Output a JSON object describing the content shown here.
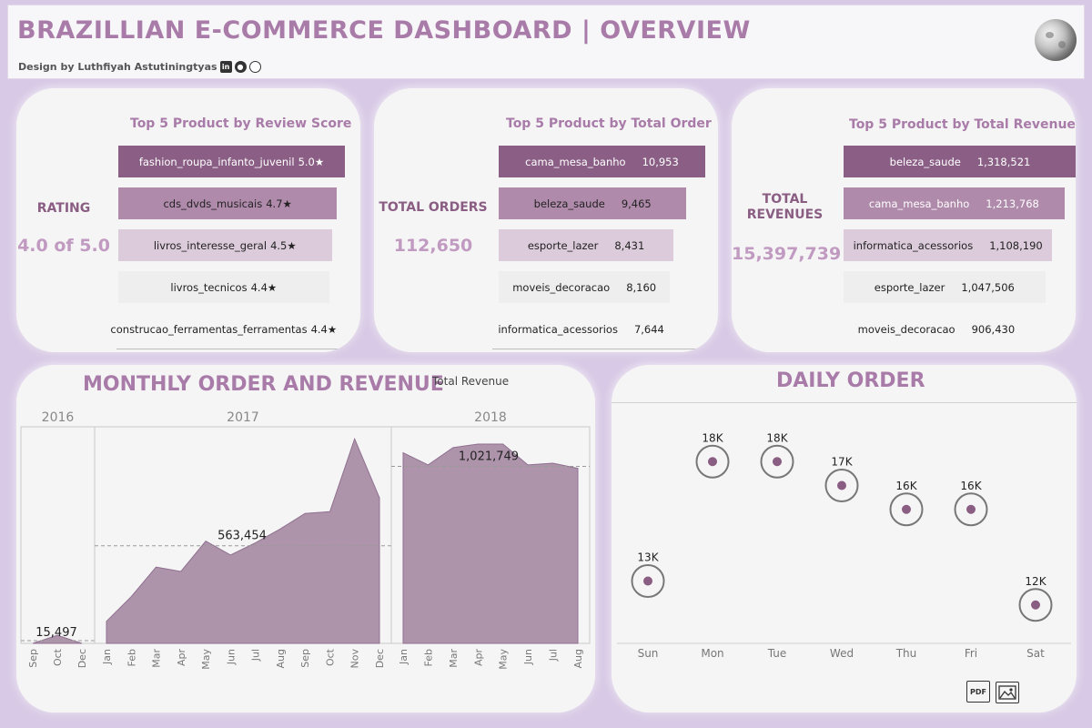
{
  "header": {
    "title": "BRAZILLIAN E-COMMERCE DASHBOARD | OVERVIEW",
    "byline": "Design by Luthfiyah Astutiningtyas"
  },
  "kpi_review": {
    "title": "Top 5 Product by Review Score",
    "label": "RATING",
    "value": "4.0 of 5.0",
    "bars": [
      {
        "name": "fashion_roupa_infanto_juvenil",
        "value": "5.0★",
        "score": 5.0
      },
      {
        "name": "cds_dvds_musicais",
        "value": "4.7★",
        "score": 4.7
      },
      {
        "name": "livros_interesse_geral",
        "value": "4.5★",
        "score": 4.5
      },
      {
        "name": "livros_tecnicos",
        "value": "4.4★",
        "score": 4.4
      },
      {
        "name": "construcao_ferramentas_ferramentas",
        "value": "4.4★",
        "score": 4.4
      }
    ]
  },
  "kpi_orders": {
    "title": "Top 5 Product by Total Order",
    "label": "TOTAL ORDERS",
    "value": "112,650",
    "bars": [
      {
        "name": "cama_mesa_banho",
        "value": "10,953",
        "amount": 10953
      },
      {
        "name": "beleza_saude",
        "value": "9,465",
        "amount": 9465
      },
      {
        "name": "esporte_lazer",
        "value": "8,431",
        "amount": 8431
      },
      {
        "name": "moveis_decoracao",
        "value": "8,160",
        "amount": 8160
      },
      {
        "name": "informatica_acessorios",
        "value": "7,644",
        "amount": 7644
      }
    ]
  },
  "kpi_revenue": {
    "title": "Top 5 Product by Total Revenue",
    "label_line1": "TOTAL",
    "label_line2": "REVENUES",
    "value": "15,397,739",
    "bars": [
      {
        "name": "beleza_saude",
        "value": "1,318,521",
        "amount": 1318521
      },
      {
        "name": "cama_mesa_banho",
        "value": "1,213,768",
        "amount": 1213768
      },
      {
        "name": "informatica_acessorios",
        "value": "1,108,190",
        "amount": 1108190
      },
      {
        "name": "esporte_lazer",
        "value": "1,047,506",
        "amount": 1047506
      },
      {
        "name": "moveis_decoracao",
        "value": "906,430",
        "amount": 906430
      }
    ]
  },
  "monthly": {
    "title": "MONTHLY ORDER AND REVENUE",
    "legend": "Total Revenue"
  },
  "daily": {
    "title": "DAILY ORDER"
  },
  "colors": {
    "accent": "#a87ba8",
    "dark_purple": "#8a5d83",
    "area_fill": "#ae94ab",
    "area_stroke": "#8f7090"
  },
  "toolbar": {
    "pdf_icon": "pdf-download-icon",
    "image_icon": "image-download-icon"
  },
  "chart_data": [
    {
      "type": "area",
      "title": "MONTHLY ORDER AND REVENUE",
      "series": [
        {
          "name": "Total Revenue"
        }
      ],
      "panels": [
        {
          "year": "2016",
          "x": [
            "Sep",
            "Oct",
            "Dec"
          ],
          "values": [
            0,
            46000,
            0
          ],
          "average": 15497,
          "average_label": "15,497"
        },
        {
          "year": "2017",
          "x": [
            "Jan",
            "Feb",
            "Mar",
            "Apr",
            "May",
            "Jun",
            "Jul",
            "Aug",
            "Sep",
            "Oct",
            "Nov",
            "Dec"
          ],
          "values": [
            127000,
            270000,
            440000,
            415000,
            590000,
            510000,
            580000,
            660000,
            750000,
            760000,
            1180000,
            840000
          ],
          "average": 563454,
          "average_label": "563,454"
        },
        {
          "year": "2018",
          "x": [
            "Jan",
            "Feb",
            "Mar",
            "Apr",
            "May",
            "Jun",
            "Jul",
            "Aug"
          ],
          "values": [
            1100000,
            1030000,
            1130000,
            1150000,
            1150000,
            1030000,
            1040000,
            1010000
          ],
          "average": 1021749,
          "average_label": "1,021,749"
        }
      ],
      "ylim": [
        0,
        1250000
      ],
      "grid": false
    },
    {
      "type": "scatter",
      "title": "DAILY ORDER",
      "categories": [
        "Sun",
        "Mon",
        "Tue",
        "Wed",
        "Thu",
        "Fri",
        "Sat"
      ],
      "values": [
        13000,
        18000,
        18000,
        17000,
        16000,
        16000,
        12000
      ],
      "labels": [
        "13K",
        "18K",
        "18K",
        "17K",
        "16K",
        "16K",
        "12K"
      ],
      "ylim": [
        11000,
        19000
      ]
    }
  ]
}
